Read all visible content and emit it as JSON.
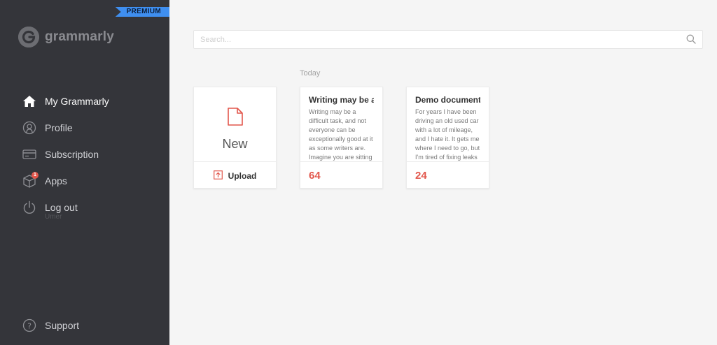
{
  "sidebar": {
    "premium_badge": "PREMIUM",
    "logo_text": "grammarly",
    "items": [
      {
        "label": "My Grammarly",
        "icon": "home-icon",
        "active": true
      },
      {
        "label": "Profile",
        "icon": "profile-icon"
      },
      {
        "label": "Subscription",
        "icon": "credit-card-icon"
      },
      {
        "label": "Apps",
        "icon": "box-icon",
        "badge": "1"
      },
      {
        "label": "Log out",
        "icon": "power-icon"
      }
    ],
    "user_name": "Umer",
    "support_label": "Support"
  },
  "search": {
    "placeholder": "Search..."
  },
  "main": {
    "section_label": "Today",
    "new_card": {
      "label": "New",
      "upload_label": "Upload"
    },
    "documents": [
      {
        "title": "Writing may be a",
        "excerpt": "Writing may be a difficult task, and not everyone can be exceptionally good at it as some writers are. Imagine you are sitting",
        "score": "64"
      },
      {
        "title": "Demo document",
        "excerpt": "For years I have been driving an old used car with a lot of mileage, and I hate it. It gets me where I need to go, but I'm tired of fixing leaks",
        "score": "24"
      }
    ]
  },
  "colors": {
    "sidebar_bg": "#34353a",
    "accent_red": "#e2574c",
    "premium_blue": "#3f8ff0",
    "page_bg": "#f5f5f5"
  }
}
